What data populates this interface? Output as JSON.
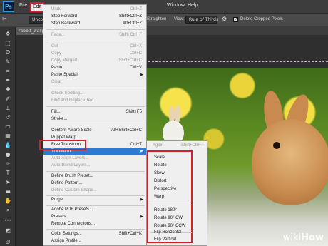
{
  "app": {
    "logo": "Ps",
    "menus": [
      "File",
      "Edit",
      "Window",
      "Help"
    ]
  },
  "options_bar": {
    "left_select": "Unconst",
    "straighten_label": "Straighten",
    "view_label": "View:",
    "view_value": "Rule of Thirds",
    "delete_cropped_label": "Delete Cropped Pixels",
    "delete_cropped_checked": true
  },
  "document_tab": "rabbit_wallp",
  "edit_menu": {
    "items": [
      {
        "label": "Undo",
        "shortcut": "Ctrl+Z",
        "disabled": true
      },
      {
        "label": "Step Forward",
        "shortcut": "Shift+Ctrl+Z",
        "disabled": false
      },
      {
        "label": "Step Backward",
        "shortcut": "Alt+Ctrl+Z",
        "disabled": false
      },
      {
        "label": "Fade...",
        "shortcut": "Shift+Ctrl+F",
        "disabled": true
      },
      {
        "label": "Cut",
        "shortcut": "Ctrl+X",
        "disabled": true
      },
      {
        "label": "Copy",
        "shortcut": "Ctrl+C",
        "disabled": true
      },
      {
        "label": "Copy Merged",
        "shortcut": "Shift+Ctrl+C",
        "disabled": true
      },
      {
        "label": "Paste",
        "shortcut": "Ctrl+V",
        "disabled": false
      },
      {
        "label": "Paste Special",
        "shortcut": "",
        "disabled": false,
        "submenu": true
      },
      {
        "label": "Clear",
        "shortcut": "",
        "disabled": true
      },
      {
        "label": "Check Spelling...",
        "shortcut": "",
        "disabled": true
      },
      {
        "label": "Find and Replace Text...",
        "shortcut": "",
        "disabled": true
      },
      {
        "label": "Fill...",
        "shortcut": "Shift+F5",
        "disabled": false
      },
      {
        "label": "Stroke...",
        "shortcut": "",
        "disabled": false
      },
      {
        "label": "Content-Aware Scale",
        "shortcut": "Alt+Shift+Ctrl+C",
        "disabled": false
      },
      {
        "label": "Puppet Warp",
        "shortcut": "",
        "disabled": false
      },
      {
        "label": "Free Transform",
        "shortcut": "Ctrl+T",
        "disabled": false
      },
      {
        "label": "Transform",
        "shortcut": "",
        "disabled": false,
        "submenu": true,
        "highlighted": true
      },
      {
        "label": "Auto-Align Layers...",
        "shortcut": "",
        "disabled": true
      },
      {
        "label": "Auto-Blend Layers...",
        "shortcut": "",
        "disabled": true
      },
      {
        "label": "Define Brush Preset...",
        "shortcut": "",
        "disabled": false
      },
      {
        "label": "Define Pattern...",
        "shortcut": "",
        "disabled": false
      },
      {
        "label": "Define Custom Shape...",
        "shortcut": "",
        "disabled": true
      },
      {
        "label": "Purge",
        "shortcut": "",
        "disabled": false,
        "submenu": true
      },
      {
        "label": "Adobe PDF Presets...",
        "shortcut": "",
        "disabled": false
      },
      {
        "label": "Presets",
        "shortcut": "",
        "disabled": false,
        "submenu": true
      },
      {
        "label": "Remote Connections...",
        "shortcut": "",
        "disabled": false
      },
      {
        "label": "Color Settings...",
        "shortcut": "Shift+Ctrl+K",
        "disabled": false
      },
      {
        "label": "Assign Profile...",
        "shortcut": "",
        "disabled": false
      }
    ]
  },
  "transform_submenu": {
    "again_label": "Again",
    "again_shortcut": "Shift+Ctrl+T",
    "items": [
      "Scale",
      "Rotate",
      "Skew",
      "Distort",
      "Perspective",
      "Warp",
      "Rotate 180°",
      "Rotate 90° CW",
      "Rotate 90° CCW",
      "Flip Horizontal",
      "Flip Vertical"
    ]
  },
  "watermark": {
    "part1": "wiki",
    "part2": "How"
  },
  "colors": {
    "highlight": "#2f7ad1",
    "annotation_red": "#d21f2b"
  }
}
